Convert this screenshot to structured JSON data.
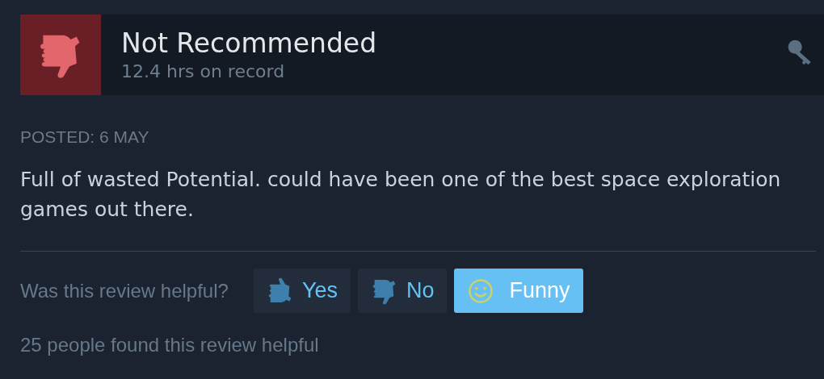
{
  "review": {
    "verdict": "Not Recommended",
    "recommended": false,
    "hours": "12.4 hrs on record"
  },
  "posted": "POSTED: 6 MAY",
  "body": "Full of wasted Potential. could have been one of the best space exploration games out there.",
  "helpful": {
    "question": "Was this review helpful?",
    "buttons": [
      {
        "kind": "thumb-up",
        "label": "Yes",
        "selected": false
      },
      {
        "kind": "thumb-down",
        "label": "No",
        "selected": false
      },
      {
        "kind": "smiley",
        "label": "Funny",
        "selected": true
      }
    ],
    "summary": "25 people found this review helpful"
  }
}
